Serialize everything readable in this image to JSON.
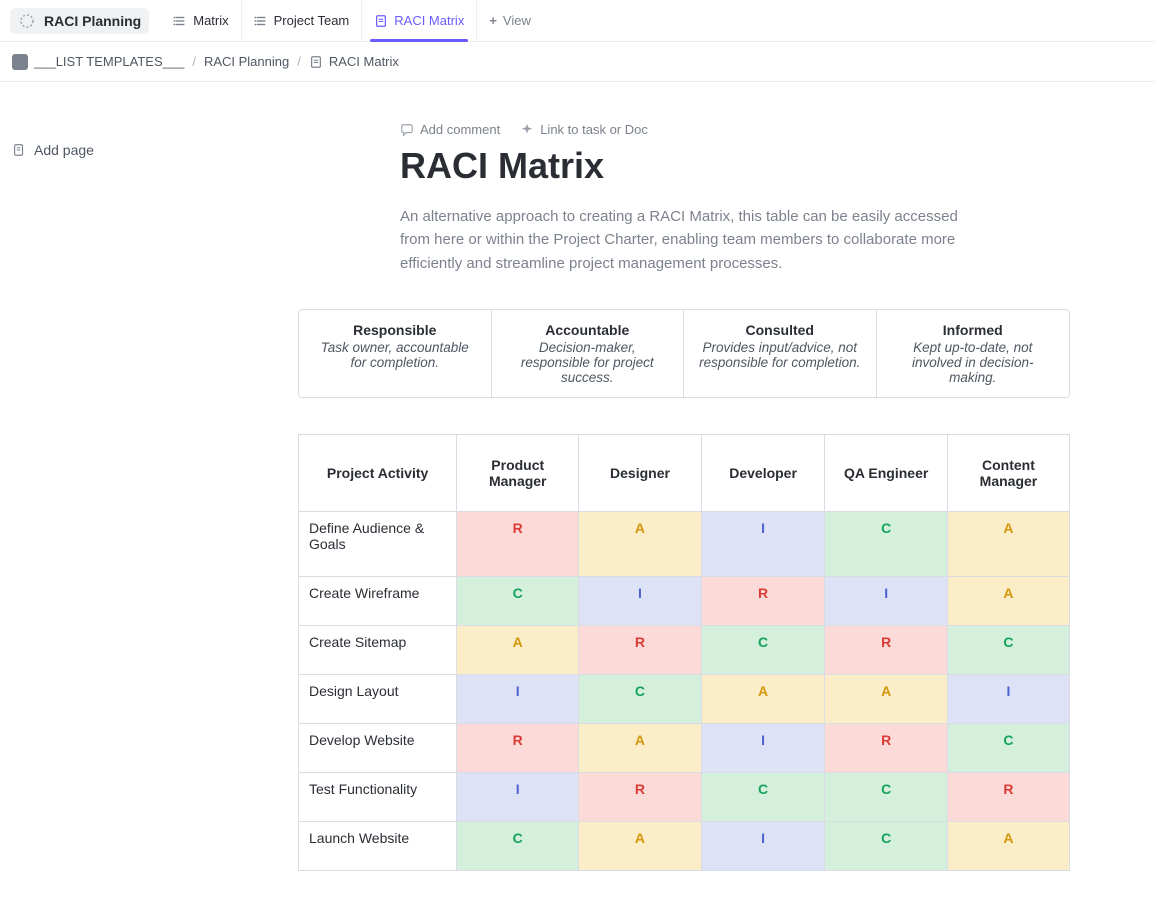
{
  "header": {
    "app_title": "RACI Planning",
    "tabs": [
      {
        "label": "Matrix",
        "icon": "list-icon",
        "active": false
      },
      {
        "label": "Project Team",
        "icon": "list-icon",
        "active": false
      },
      {
        "label": "RACI Matrix",
        "icon": "doc-icon",
        "active": true
      }
    ],
    "add_view_label": "View"
  },
  "breadcrumb": {
    "items": [
      "___LIST TEMPLATES___",
      "RACI Planning",
      "RACI Matrix"
    ]
  },
  "sidebar": {
    "add_page_label": "Add page"
  },
  "doc": {
    "add_comment_label": "Add comment",
    "link_task_label": "Link to task or Doc",
    "title": "RACI Matrix",
    "description": "An alternative approach to creating a RACI Matrix, this table can be easily accessed from here or within the Project Charter, enabling team members to collaborate more efficiently and streamline project management processes."
  },
  "definitions": [
    {
      "title": "Responsible",
      "desc": "Task owner, accountable for completion."
    },
    {
      "title": "Accountable",
      "desc": "Decision-maker, responsible for project success."
    },
    {
      "title": "Consulted",
      "desc": "Provides input/advice, not responsible for completion."
    },
    {
      "title": "Informed",
      "desc": "Kept up-to-date, not involved in decision-making."
    }
  ],
  "matrix": {
    "activity_header": "Project Activity",
    "roles": [
      "Product Manager",
      "Designer",
      "Developer",
      "QA Engineer",
      "Content Manager"
    ],
    "rows": [
      {
        "activity": "Define Audience & Goals",
        "cells": [
          "R",
          "A",
          "I",
          "C",
          "A"
        ]
      },
      {
        "activity": "Create Wireframe",
        "cells": [
          "C",
          "I",
          "R",
          "I",
          "A"
        ]
      },
      {
        "activity": "Create Sitemap",
        "cells": [
          "A",
          "R",
          "C",
          "R",
          "C"
        ]
      },
      {
        "activity": "Design Layout",
        "cells": [
          "I",
          "C",
          "A",
          "A",
          "I"
        ]
      },
      {
        "activity": "Develop Website",
        "cells": [
          "R",
          "A",
          "I",
          "R",
          "C"
        ]
      },
      {
        "activity": "Test Functionality",
        "cells": [
          "I",
          "R",
          "C",
          "C",
          "R"
        ]
      },
      {
        "activity": "Launch Website",
        "cells": [
          "C",
          "A",
          "I",
          "C",
          "A"
        ]
      }
    ]
  }
}
